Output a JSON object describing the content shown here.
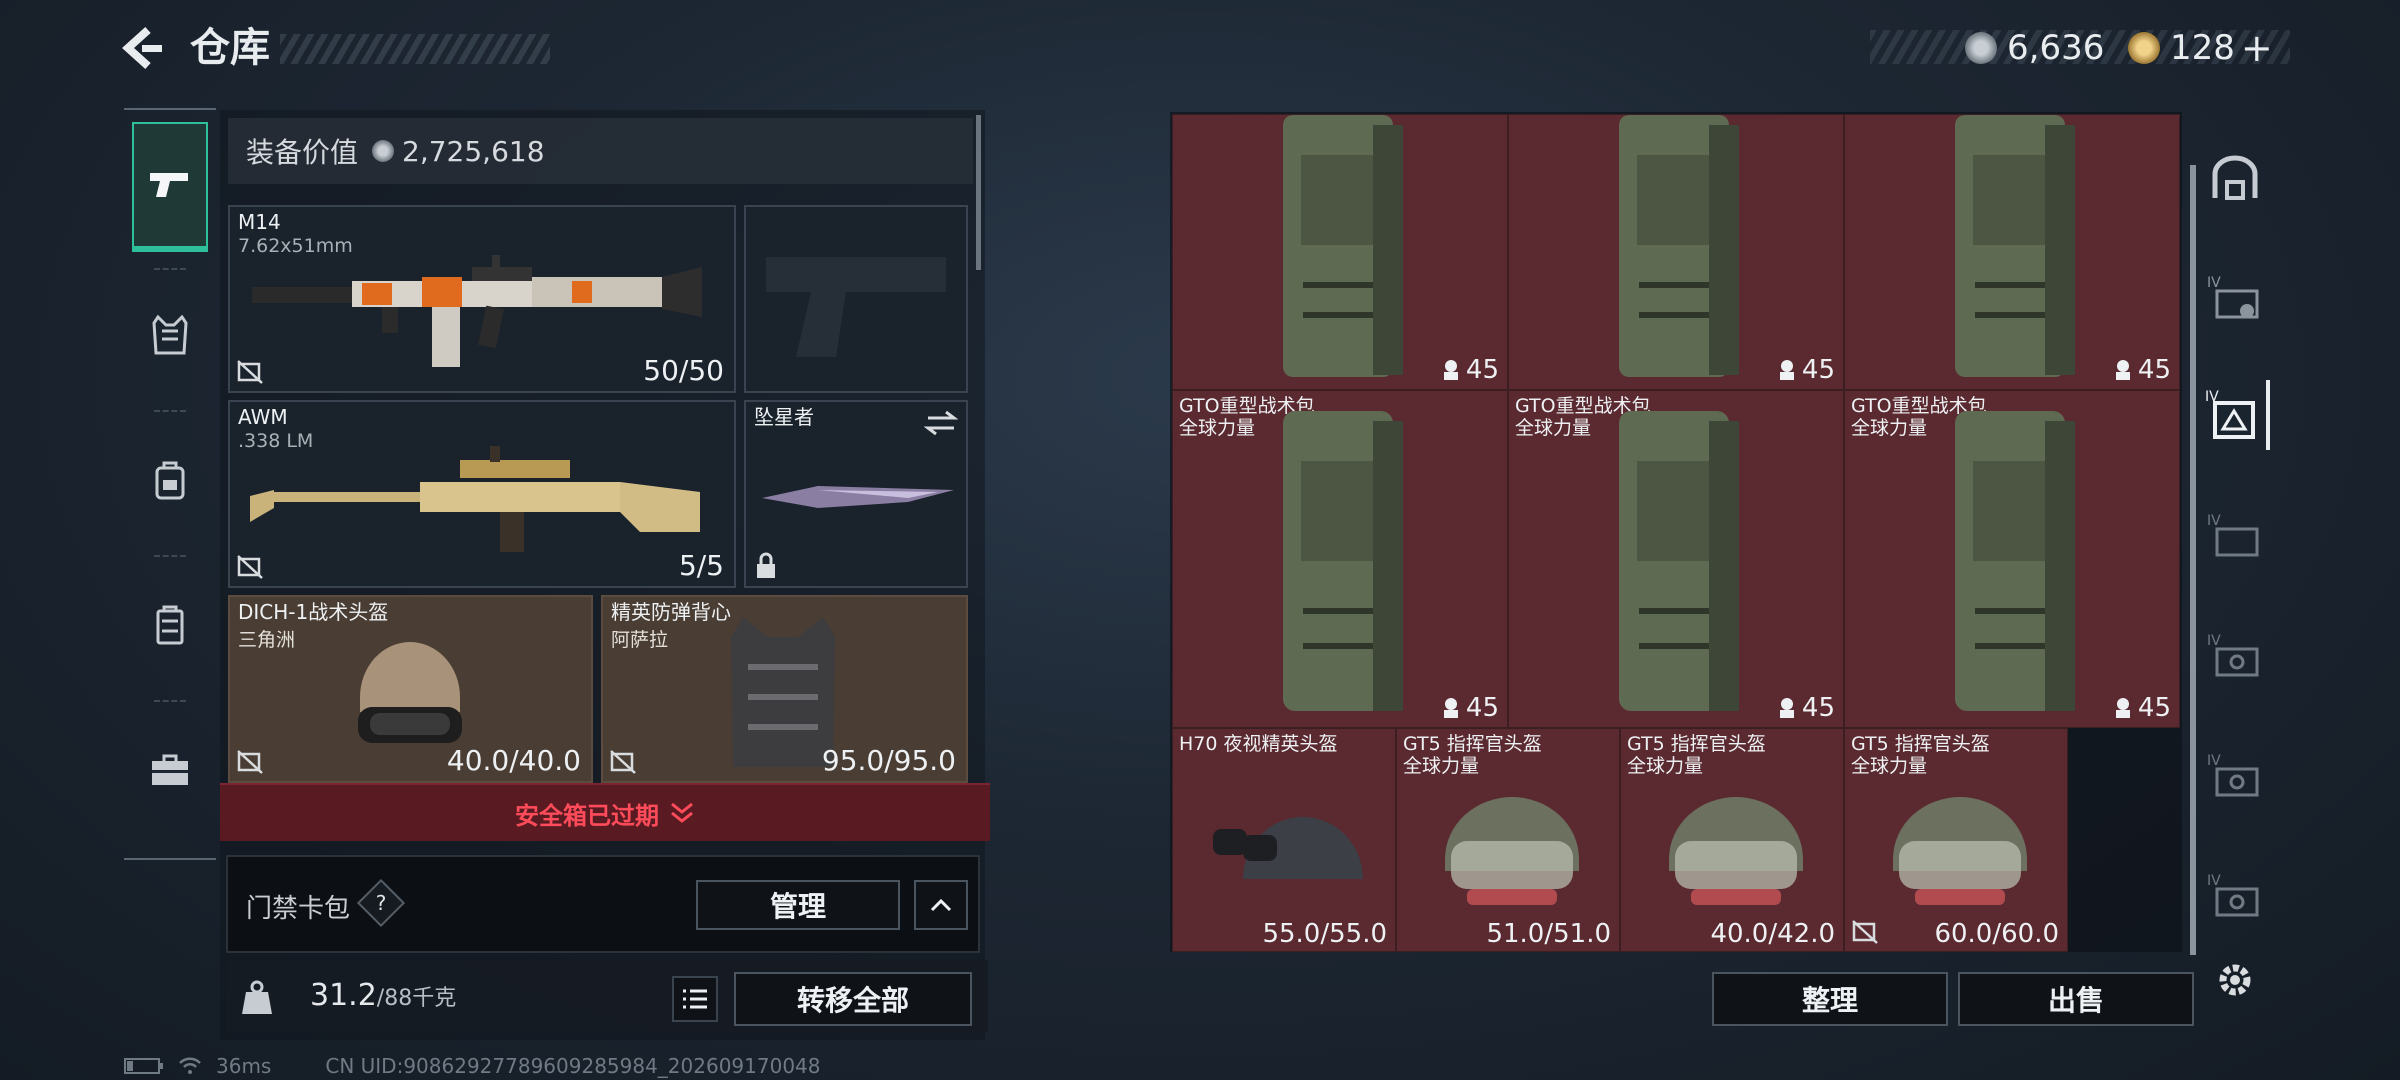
{
  "header": {
    "title": "仓库",
    "currency_silver": "6,636",
    "currency_gold": "128",
    "add_label": "+"
  },
  "rail": [
    "gun-icon",
    "armor-vest-icon",
    "backpack-icon",
    "chest-rig-icon",
    "briefcase-icon"
  ],
  "loadout": {
    "value_label": "装备价值",
    "value": "2,725,618",
    "primary": {
      "name": "M14",
      "caliber": "7.62x51mm",
      "ammo": "50/50"
    },
    "secondary": {
      "name": "AWM",
      "caliber": ".338 LM",
      "ammo": "5/5"
    },
    "melee": {
      "name": "坠星者"
    },
    "helmet": {
      "name": "DICH-1战术头盔",
      "origin": "三角洲",
      "durability": "40.0/40.0"
    },
    "armor": {
      "name": "精英防弹背心",
      "origin": "阿萨拉",
      "durability": "95.0/95.0"
    },
    "safebox_expired": "安全箱已过期",
    "keycard_label": "门禁卡包",
    "help": "?",
    "manage": "管理",
    "weight": "31.2",
    "weight_max": "/88千克",
    "transfer_all": "转移全部"
  },
  "stash": {
    "backpacks_top": [
      {
        "count": "45"
      },
      {
        "count": "45"
      },
      {
        "count": "45"
      }
    ],
    "backpacks_mid": [
      {
        "name": "GTO重型战术包",
        "sub": "全球力量",
        "count": "45"
      },
      {
        "name": "GTO重型战术包",
        "sub": "全球力量",
        "count": "45"
      },
      {
        "name": "GTO重型战术包",
        "sub": "全球力量",
        "count": "45"
      }
    ],
    "helmets": [
      {
        "name": "H70 夜视精英头盔",
        "sub": "",
        "durability": "55.0/55.0"
      },
      {
        "name": "GT5 指挥官头盔",
        "sub": "全球力量",
        "durability": "51.0/51.0"
      },
      {
        "name": "GT5 指挥官头盔",
        "sub": "全球力量",
        "durability": "40.0/42.0"
      },
      {
        "name": "GT5 指挥官头盔",
        "sub": "全球力量",
        "durability": "60.0/60.0"
      }
    ],
    "sort": "整理",
    "sell": "出售"
  },
  "right_rail": [
    "stash-icon",
    "stash-tab-1-icon",
    "stash-tab-2-icon",
    "stash-tab-3-icon",
    "stash-tab-4-icon",
    "stash-tab-5-icon",
    "stash-tab-6-icon",
    "settings-icon"
  ],
  "right_rail_tier": "IV",
  "status": {
    "ping": "36ms",
    "uid": "CN UID:9086292778960928598​4_202609170048"
  }
}
